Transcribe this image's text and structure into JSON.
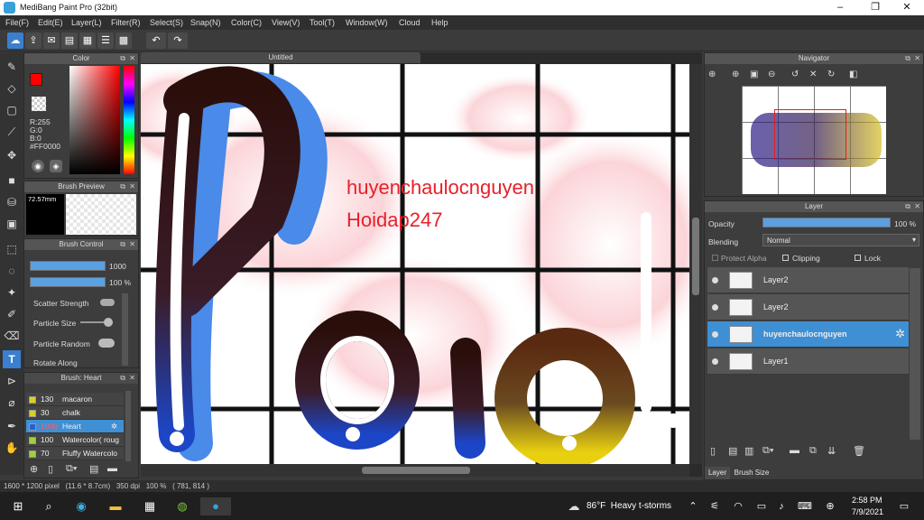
{
  "app": {
    "title": "MediBang Paint Pro (32bit)"
  },
  "menu": [
    "File(F)",
    "Edit(E)",
    "Layer(L)",
    "Filter(R)",
    "Select(S)",
    "Snap(N)",
    "Color(C)",
    "View(V)",
    "Tool(T)",
    "Window(W)",
    "Cloud",
    "Help"
  ],
  "color_panel": {
    "title": "Color",
    "r": "R:255",
    "g": "G:0",
    "b": "B:0",
    "hex": "#FF0000",
    "primary_color": "#ff0000"
  },
  "brush_preview": {
    "title": "Brush Preview",
    "size": "72.57mm"
  },
  "brush_control": {
    "title": "Brush Control",
    "size_value": "1000",
    "opacity_value": "100 %",
    "scatter_strength": "Scatter Strength",
    "particle_size": "Particle Size",
    "particle_random": "Particle Random",
    "rotate_along": "Rotate Along"
  },
  "brush_list": {
    "title": "Brush: Heart",
    "items": [
      {
        "size": "130",
        "name": "macaron"
      },
      {
        "size": "30",
        "name": "chalk"
      },
      {
        "size": "1000",
        "name": "Heart",
        "selected": true
      },
      {
        "size": "100",
        "name": "Watercolor( roug"
      },
      {
        "size": "70",
        "name": "Fluffy Watercolo"
      }
    ]
  },
  "document": {
    "tab": "Untitled",
    "text_line1": "huyenchaulocnguyen",
    "text_line2": "Hoidap247",
    "text_color": "#e8202a"
  },
  "navigator": {
    "title": "Navigator"
  },
  "layer_panel": {
    "title": "Layer",
    "opacity_label": "Opacity",
    "opacity_value": "100 %",
    "blending_label": "Blending",
    "blending_value": "Normal",
    "protect_alpha": "Protect Alpha",
    "clipping": "Clipping",
    "lock": "Lock",
    "layers": [
      {
        "name": "Layer2",
        "selected": false
      },
      {
        "name": "Layer2",
        "selected": false
      },
      {
        "name": "huyenchaulocnguyen",
        "selected": true
      },
      {
        "name": "Layer1",
        "selected": false
      }
    ],
    "tab_layer": "Layer",
    "tab_brush_size": "Brush Size"
  },
  "status": {
    "text": "1600 * 1200 pixel   (11.6 * 8.7cm)   350 dpi   100 %   ( 781, 814 )"
  },
  "taskbar": {
    "weather": "86°F  Heavy t-storms",
    "time": "2:58 PM",
    "date": "7/9/2021"
  }
}
